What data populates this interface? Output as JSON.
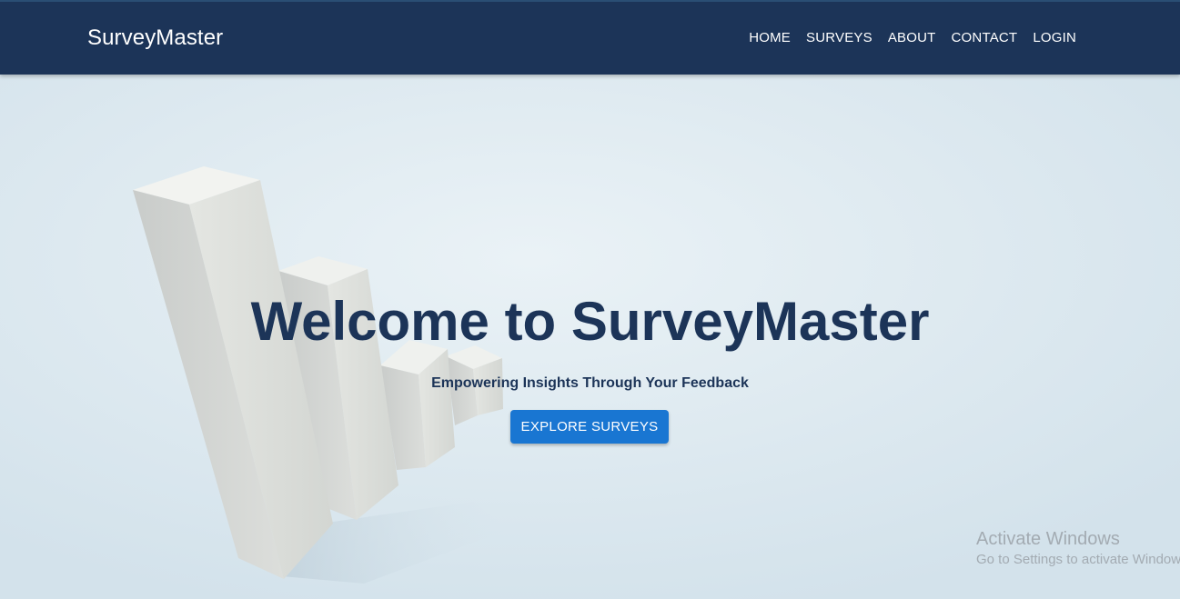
{
  "navbar": {
    "brand": "SurveyMaster",
    "links": [
      "HOME",
      "SURVEYS",
      "ABOUT",
      "CONTACT",
      "LOGIN"
    ]
  },
  "hero": {
    "title": "Welcome to SurveyMaster",
    "subtitle": "Empowering Insights Through Your Feedback",
    "cta_label": "EXPLORE SURVEYS",
    "background_image": "bar-chart-3d-image"
  },
  "watermark": {
    "title": "Activate Windows",
    "subtitle": "Go to Settings to activate Windows."
  },
  "colors": {
    "navbar_bg": "#1c3458",
    "title_text": "#1c3458",
    "cta_bg": "#1976d2",
    "page_bg": "#d8e6ee"
  }
}
